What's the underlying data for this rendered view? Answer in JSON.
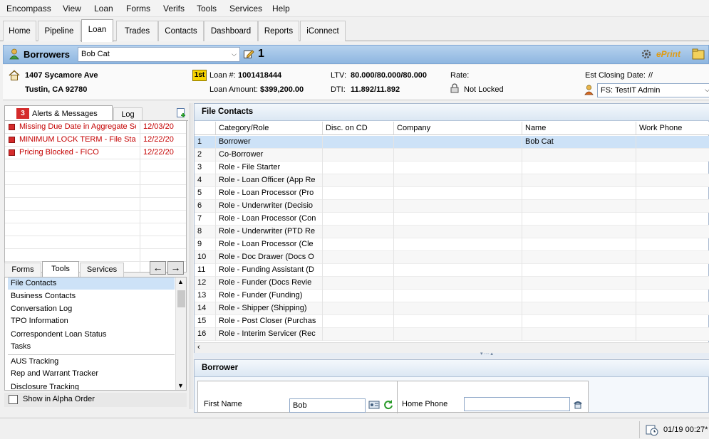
{
  "menu": [
    "Encompass",
    "View",
    "Loan",
    "Forms",
    "Verifs",
    "Tools",
    "Services",
    "Help"
  ],
  "tabs": [
    "Home",
    "Pipeline",
    "Loan",
    "Trades",
    "Contacts",
    "Dashboard",
    "Reports",
    "iConnect"
  ],
  "active_tab": "Loan",
  "borrowers_header": {
    "title": "Borrowers",
    "selected_borrower": "Bob Cat",
    "pair_number": "1",
    "eprint_label": "ePrint"
  },
  "summary": {
    "address_line1": "1407 Sycamore Ave",
    "address_line2": "Tustin, CA 92780",
    "lien_badge": "1st",
    "loan_number_label": "Loan #:",
    "loan_number": "1001418444",
    "loan_amount_label": "Loan Amount:",
    "loan_amount": "$399,200.00",
    "ltv_label": "LTV:",
    "ltv": "80.000/80.000/80.000",
    "dti_label": "DTI:",
    "dti": "11.892/11.892",
    "rate_label": "Rate:",
    "lock_status": "Not Locked",
    "closing_label": "Est Closing Date:",
    "closing_value": "//",
    "assignee": "FS: TestIT Admin"
  },
  "alerts": {
    "count": "3",
    "tab_alerts": "Alerts & Messages",
    "tab_log": "Log",
    "items": [
      {
        "text": "Missing Due Date in Aggregate Se",
        "date": "12/03/20"
      },
      {
        "text": "MINIMUM LOCK TERM - File Starte",
        "date": "12/22/20"
      },
      {
        "text": "Pricing Blocked - FICO",
        "date": "12/22/20"
      }
    ]
  },
  "tools": {
    "tabs": [
      "Forms",
      "Tools",
      "Services"
    ],
    "active": "Tools",
    "items": [
      "File Contacts",
      "Business Contacts",
      "Conversation Log",
      "TPO Information",
      "Correspondent Loan Status",
      "Tasks",
      "AUS Tracking",
      "Rep and Warrant Tracker",
      "Disclosure Tracking"
    ],
    "selected": "File Contacts",
    "alpha_label": "Show in Alpha Order"
  },
  "file_contacts": {
    "title": "File Contacts",
    "columns": [
      "Category/Role",
      "Disc. on CD",
      "Company",
      "Name",
      "Work Phone"
    ],
    "rows": [
      {
        "n": "1",
        "role": "Borrower",
        "name": "Bob Cat"
      },
      {
        "n": "2",
        "role": "Co-Borrower",
        "name": ""
      },
      {
        "n": "3",
        "role": "Role - File Starter",
        "name": ""
      },
      {
        "n": "4",
        "role": "Role - Loan Officer (App Re",
        "name": ""
      },
      {
        "n": "5",
        "role": "Role - Loan Processor (Pro",
        "name": ""
      },
      {
        "n": "6",
        "role": "Role - Underwriter (Decisio",
        "name": ""
      },
      {
        "n": "7",
        "role": "Role - Loan Processor (Con",
        "name": ""
      },
      {
        "n": "8",
        "role": "Role - Underwriter (PTD Re",
        "name": ""
      },
      {
        "n": "9",
        "role": "Role - Loan Processor (Cle",
        "name": ""
      },
      {
        "n": "10",
        "role": "Role - Doc Drawer (Docs O",
        "name": ""
      },
      {
        "n": "11",
        "role": "Role - Funding Assistant (D",
        "name": ""
      },
      {
        "n": "12",
        "role": "Role - Funder (Docs Revie",
        "name": ""
      },
      {
        "n": "13",
        "role": "Role - Funder (Funding)",
        "name": ""
      },
      {
        "n": "14",
        "role": "Role - Shipper (Shipping)",
        "name": ""
      },
      {
        "n": "15",
        "role": "Role - Post Closer (Purchas",
        "name": ""
      },
      {
        "n": "16",
        "role": "Role - Interim Servicer (Rec",
        "name": ""
      }
    ]
  },
  "borrower_detail": {
    "title": "Borrower",
    "first_name_label": "First Name",
    "first_name_value": "Bob",
    "home_phone_label": "Home Phone",
    "home_phone_value": ""
  },
  "status_bar": {
    "timestamp": "01/19 00:27*"
  },
  "colors": {
    "header_blue": "#9fc2e7",
    "alert_red": "#c40000",
    "selection": "#cde2f7"
  }
}
